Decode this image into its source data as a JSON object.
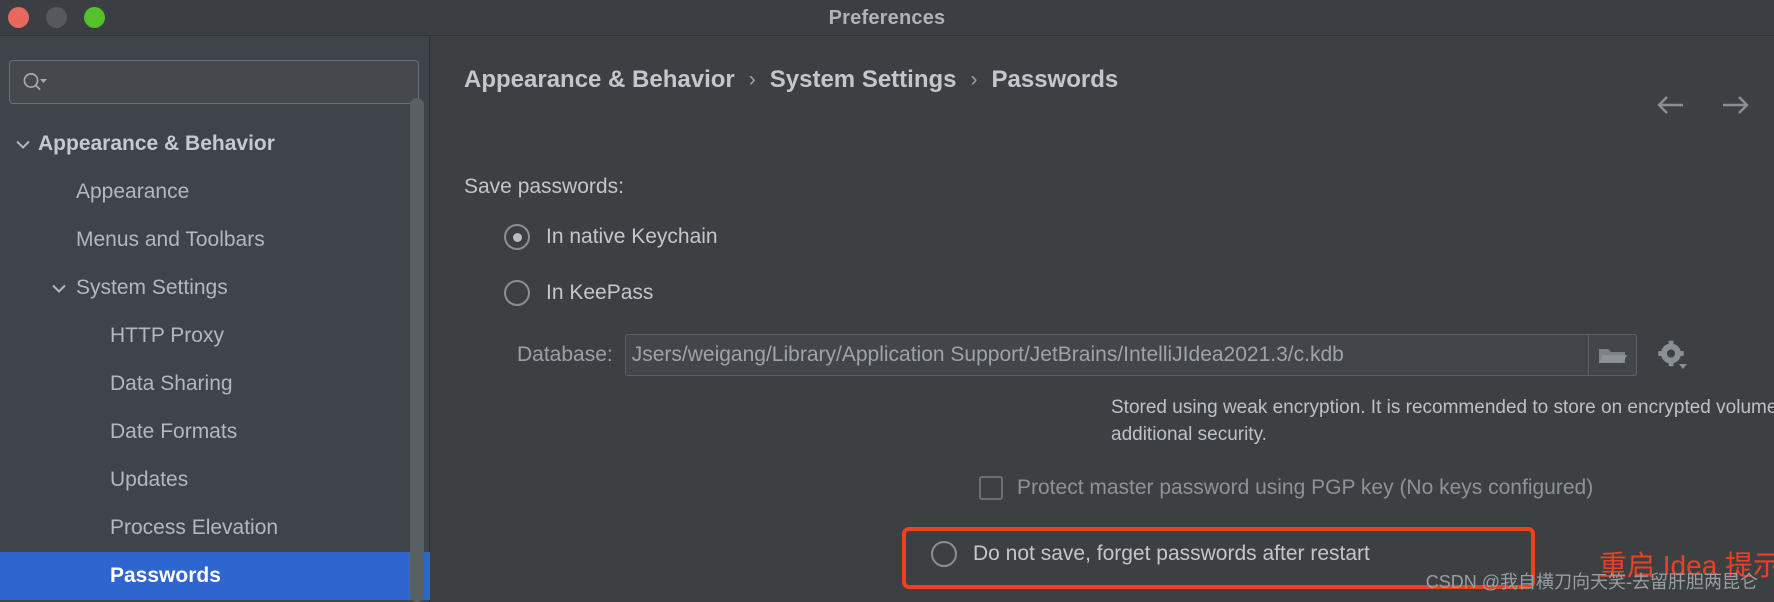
{
  "window": {
    "title": "Preferences",
    "traffic_lights": [
      "close-button",
      "minimize-button",
      "zoom-button"
    ]
  },
  "sidebar": {
    "search": {
      "value": "",
      "placeholder": ""
    },
    "items": [
      {
        "label": "Appearance & Behavior",
        "indent": 38,
        "twisty": "chevron-down",
        "bold": true,
        "selected": false
      },
      {
        "label": "Appearance",
        "indent": 76,
        "twisty": "",
        "bold": false,
        "selected": false
      },
      {
        "label": "Menus and Toolbars",
        "indent": 76,
        "twisty": "",
        "bold": false,
        "selected": false
      },
      {
        "label": "System Settings",
        "indent": 76,
        "twisty": "chevron-down",
        "bold": false,
        "selected": false
      },
      {
        "label": "HTTP Proxy",
        "indent": 110,
        "twisty": "",
        "bold": false,
        "selected": false
      },
      {
        "label": "Data Sharing",
        "indent": 110,
        "twisty": "",
        "bold": false,
        "selected": false
      },
      {
        "label": "Date Formats",
        "indent": 110,
        "twisty": "",
        "bold": false,
        "selected": false
      },
      {
        "label": "Updates",
        "indent": 110,
        "twisty": "",
        "bold": false,
        "selected": false
      },
      {
        "label": "Process Elevation",
        "indent": 110,
        "twisty": "",
        "bold": false,
        "selected": false
      },
      {
        "label": "Passwords",
        "indent": 110,
        "twisty": "",
        "bold": true,
        "selected": true
      }
    ]
  },
  "main": {
    "breadcrumb": {
      "part1": "Appearance & Behavior",
      "sep1": "›",
      "part2": "System Settings",
      "sep2": "›",
      "part3": "Passwords"
    },
    "nav": {
      "back": "back-arrow",
      "forward": "forward-arrow"
    },
    "save_passwords_label": "Save passwords:",
    "options": [
      {
        "label": "In native Keychain",
        "selected": true
      },
      {
        "label": "In KeePass",
        "selected": false
      },
      {
        "label": "Do not save, forget passwords after restart",
        "selected": false
      }
    ],
    "database": {
      "label": "Database:",
      "value": "Jsers/weigang/Library/Application Support/JetBrains/IntelliJIdea2021.3/c.kdb",
      "browse_icon": "folder-icon",
      "gear_icon": "gear-icon"
    },
    "warning": "Stored using weak encryption. It is recommended to store on encrypted volume for additional security.",
    "pgp": {
      "label": "Protect master password using PGP key (No keys configured)",
      "checked": false,
      "select_value": ""
    },
    "annotation": "重启 Idea 提示输入密码",
    "watermark": "CSDN @我自横刀向天笑-去留肝胆两昆仑"
  },
  "colors": {
    "accent_selection": "#2f65ce",
    "highlight_border": "#f04020",
    "annotation_text": "#ef3f23",
    "window_bg": "#3c4043",
    "sidebar_bg": "#3f434a"
  }
}
